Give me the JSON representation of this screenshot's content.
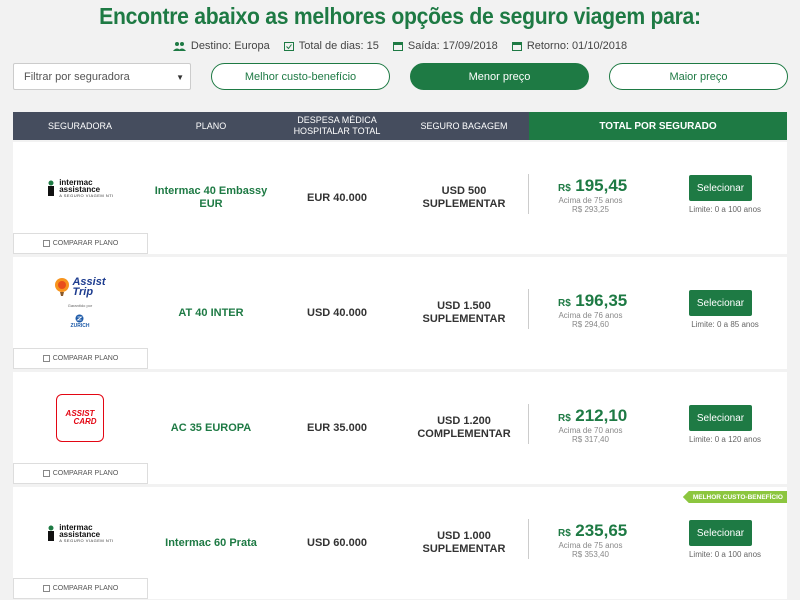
{
  "header": {
    "title": "Encontre abaixo as melhores opções de seguro viagem para:",
    "destination": "Destino: Europa",
    "days": "Total de dias: 15",
    "departure": "Saída: 17/09/2018",
    "return": "Retorno: 01/10/2018"
  },
  "filter": {
    "placeholder": "Filtrar por seguradora"
  },
  "sort": {
    "best_value": "Melhor custo-benefício",
    "lowest_price": "Menor preço",
    "highest_price": "Maior preço"
  },
  "table": {
    "col_insurer": "SEGURADORA",
    "col_plan": "PLANO",
    "col_medical": "DESPESA MÉDICA HOSPITALAR TOTAL",
    "col_baggage": "SEGURO BAGAGEM",
    "col_total": "TOTAL POR SEGURADO"
  },
  "compare_label": "COMPARAR PLANO",
  "select_label": "Selecionar",
  "currency": "R$",
  "badge_label": "MELHOR CUSTO-BENEFÍCIO",
  "logos": {
    "intermac_line1": "intermac",
    "intermac_line2": "assistance",
    "intermac_tag": "A SEGURO VIAGEM NTI",
    "assist_line1": "Assist",
    "assist_line2": "Trip",
    "assist_tag": "Garantido por",
    "zurich": "ZURICH",
    "assistcard_line1": "ASSIST",
    "assistcard_line2": "CARD"
  },
  "plans": [
    {
      "insurer": "intermac",
      "plan": "Intermac 40 Embassy EUR",
      "medical": "EUR 40.000",
      "baggage": "USD 500 SUPLEMENTAR",
      "price": "195,45",
      "age": "Acima de 75 anos",
      "age_price": "R$ 293,25",
      "limit": "Limite: 0 a 100 anos"
    },
    {
      "insurer": "assisttrip",
      "plan": "AT 40 INTER",
      "medical": "USD 40.000",
      "baggage": "USD 1.500 SUPLEMENTAR",
      "price": "196,35",
      "age": "Acima de 76 anos",
      "age_price": "R$ 294,60",
      "limit": "Limite: 0 a 85 anos"
    },
    {
      "insurer": "assistcard",
      "plan": "AC 35 EUROPA",
      "medical": "EUR 35.000",
      "baggage": "USD 1.200 COMPLEMENTAR",
      "price": "212,10",
      "age": "Acima de 70 anos",
      "age_price": "R$ 317,40",
      "limit": "Limite: 0 a 120 anos"
    },
    {
      "insurer": "intermac",
      "plan": "Intermac 60 Prata",
      "medical": "USD 60.000",
      "baggage": "USD 1.000 SUPLEMENTAR",
      "price": "235,65",
      "age": "Acima de 75 anos",
      "age_price": "R$ 353,40",
      "limit": "Limite: 0 a 100 anos"
    }
  ],
  "colors": {
    "brand": "#1e7a44",
    "header_bg": "#454d5e",
    "badge": "#8cc63f"
  }
}
